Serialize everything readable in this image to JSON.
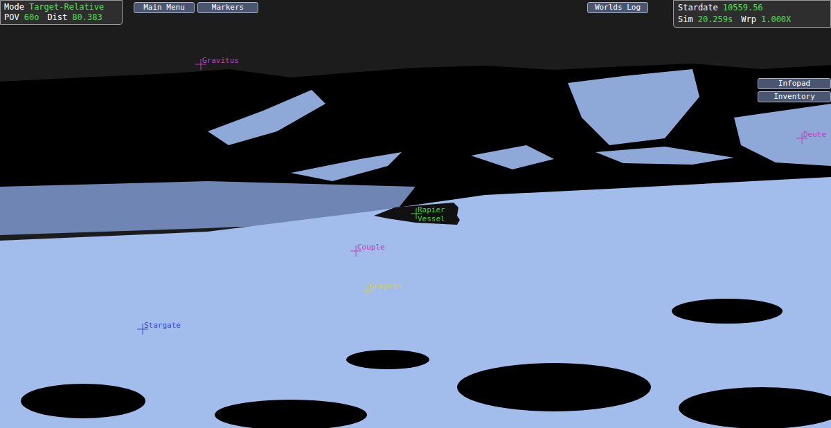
{
  "hud": {
    "left_panel": [
      [
        {
          "label": "Mode",
          "value": "Target-Relative"
        }
      ],
      [
        {
          "label": "POV",
          "value": "60o"
        },
        {
          "label": "Dist",
          "value": "80.383"
        }
      ]
    ],
    "right_panel": [
      [
        {
          "label": "Stardate",
          "value": "10559.56"
        }
      ],
      [
        {
          "label": "Sim",
          "value": "20.259s"
        },
        {
          "label": "Wrp",
          "value": "1.000X"
        }
      ]
    ]
  },
  "top_buttons": {
    "left": [
      "Main Menu",
      "Markers"
    ],
    "right": [
      "Worlds Log"
    ]
  },
  "side_buttons": [
    "Infopad",
    "Inventory"
  ],
  "markers": [
    {
      "lines": [
        "Gravitus"
      ],
      "color": "#c040c0"
    },
    {
      "lines": [
        "Deute"
      ],
      "color": "#c040c0"
    },
    {
      "lines": [
        "Couple"
      ],
      "color": "#c040c0"
    },
    {
      "lines": [
        "Graykin"
      ],
      "color": "#d4d040"
    },
    {
      "lines": [
        "Stargate"
      ],
      "color": "#3848d8"
    },
    {
      "lines": [
        "Rapier",
        "Vessel"
      ],
      "color": "#40d040"
    }
  ]
}
